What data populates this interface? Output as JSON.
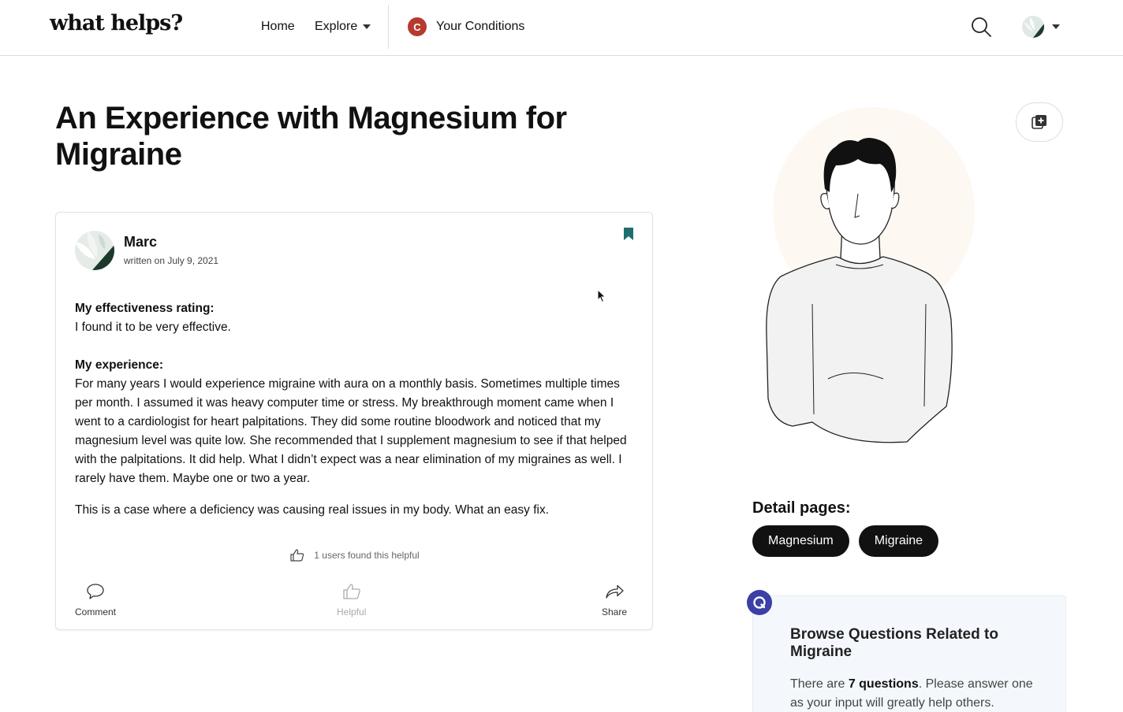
{
  "header": {
    "logo": "what helps?",
    "nav": {
      "home": "Home",
      "explore": "Explore",
      "conditions": "Your Conditions",
      "conditions_badge": "C"
    }
  },
  "page": {
    "title": "An Experience with Magnesium for Migraine"
  },
  "post": {
    "author": "Marc",
    "date": "written on July 9, 2021",
    "rating_label": "My effectiveness rating:",
    "rating_text": "I found it to be very effective.",
    "experience_label": "My experience:",
    "experience_text": "For many years I would experience migraine with aura on a monthly basis. Sometimes multiple times per month. I assumed it was heavy computer time or stress. My breakthrough moment came when I went to a cardiologist for heart palpitations. They did some routine bloodwork and noticed that my magnesium level was quite low. She recommended that I supplement magnesium to see if that helped with the palpitations. It did help. What I didn’t expect was a near elimination of my migraines as well. I rarely have them. Maybe one or two a year.",
    "closing_text": "This is a case where a deficiency was causing real issues in my body. What an easy fix.",
    "helpful_count": "1 users found this helpful",
    "actions": {
      "comment": "Comment",
      "helpful": "Helpful",
      "share": "Share"
    }
  },
  "sidebar": {
    "detail_heading": "Detail pages:",
    "tags": [
      "Magnesium",
      "Migraine"
    ],
    "qa": {
      "title": "Browse Questions Related to Migraine",
      "text_before": "There are ",
      "count": "7 questions",
      "text_after": ". Please answer one as your input will greatly help others."
    }
  },
  "colors": {
    "brand_red": "#b73a2f",
    "bookmark_teal": "#1f6e6e",
    "qa_indigo": "#3b3fa6"
  }
}
